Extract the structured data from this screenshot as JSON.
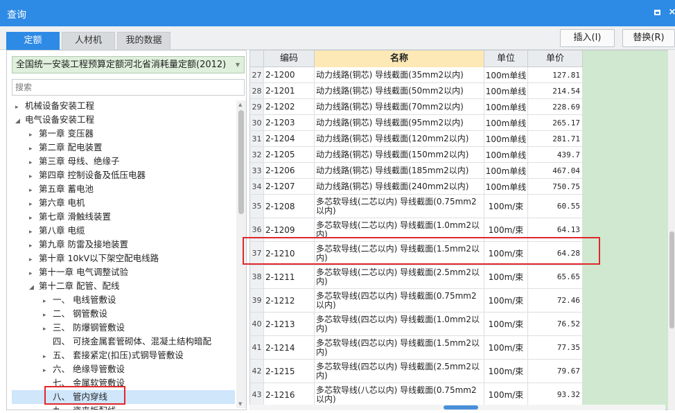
{
  "window": {
    "title": "查询",
    "maximize_icon": "maximize-icon",
    "close_label": "×"
  },
  "tabs": [
    {
      "label": "定额",
      "active": true
    },
    {
      "label": "人材机",
      "active": false
    },
    {
      "label": "我的数据",
      "active": false
    }
  ],
  "toolbar": {
    "insert_label": "插入(I)",
    "replace_label": "替换(R)"
  },
  "left": {
    "quota_combo": "全国统一安装工程预算定额河北省消耗量定额(2012)",
    "search_placeholder": "搜索",
    "tree": [
      {
        "label": "机械设备安装工程",
        "level": 0,
        "expander": "▸"
      },
      {
        "label": "电气设备安装工程",
        "level": 0,
        "expander": "◢"
      },
      {
        "label": "第一章 变压器",
        "level": 1,
        "expander": "▸"
      },
      {
        "label": "第二章 配电装置",
        "level": 1,
        "expander": "▸"
      },
      {
        "label": "第三章 母线、绝缘子",
        "level": 1,
        "expander": "▸"
      },
      {
        "label": "第四章 控制设备及低压电器",
        "level": 1,
        "expander": "▸"
      },
      {
        "label": "第五章 蓄电池",
        "level": 1,
        "expander": "▸"
      },
      {
        "label": "第六章 电机",
        "level": 1,
        "expander": "▸"
      },
      {
        "label": "第七章 滑触线装置",
        "level": 1,
        "expander": "▸"
      },
      {
        "label": "第八章 电缆",
        "level": 1,
        "expander": "▸"
      },
      {
        "label": "第九章 防雷及接地装置",
        "level": 1,
        "expander": "▸"
      },
      {
        "label": "第十章 10kV以下架空配电线路",
        "level": 1,
        "expander": "▸"
      },
      {
        "label": "第十一章 电气调整试验",
        "level": 1,
        "expander": "▸"
      },
      {
        "label": "第十二章 配管、配线",
        "level": 1,
        "expander": "◢"
      },
      {
        "label": "一、 电线管敷设",
        "level": 2,
        "expander": "▸"
      },
      {
        "label": "二、 钢管敷设",
        "level": 2,
        "expander": "▸"
      },
      {
        "label": "三、 防爆钢管敷设",
        "level": 2,
        "expander": "▸"
      },
      {
        "label": "四、 可挠金属套管砌体、混凝土结构暗配",
        "level": 2,
        "expander": ""
      },
      {
        "label": "五、 套接紧定(扣压)式钢导管敷设",
        "level": 2,
        "expander": "▸"
      },
      {
        "label": "六、 绝缘导管敷设",
        "level": 2,
        "expander": "▸"
      },
      {
        "label": "七、 金属软管敷设",
        "level": 2,
        "expander": ""
      },
      {
        "label": "八、 管内穿线",
        "level": 2,
        "expander": "",
        "selected": true
      },
      {
        "label": "九、 瓷夹板配线",
        "level": 2,
        "expander": ""
      }
    ]
  },
  "grid": {
    "headers": {
      "code": "编码",
      "name": "名称",
      "unit": "单位",
      "price": "单价"
    },
    "rows": [
      {
        "num": "27",
        "code": "2-1200",
        "name": "动力线路(铜芯) 导线截面(35mm2以内)",
        "unit": "100m单线",
        "price": "127.81",
        "tall": false
      },
      {
        "num": "28",
        "code": "2-1201",
        "name": "动力线路(铜芯) 导线截面(50mm2以内)",
        "unit": "100m单线",
        "price": "214.54",
        "tall": false
      },
      {
        "num": "29",
        "code": "2-1202",
        "name": "动力线路(铜芯) 导线截面(70mm2以内)",
        "unit": "100m单线",
        "price": "228.69",
        "tall": false
      },
      {
        "num": "30",
        "code": "2-1203",
        "name": "动力线路(铜芯) 导线截面(95mm2以内)",
        "unit": "100m单线",
        "price": "265.17",
        "tall": false
      },
      {
        "num": "31",
        "code": "2-1204",
        "name": "动力线路(铜芯) 导线截面(120mm2以内)",
        "unit": "100m单线",
        "price": "281.71",
        "tall": false
      },
      {
        "num": "32",
        "code": "2-1205",
        "name": "动力线路(铜芯) 导线截面(150mm2以内)",
        "unit": "100m单线",
        "price": "439.7",
        "tall": false
      },
      {
        "num": "33",
        "code": "2-1206",
        "name": "动力线路(铜芯) 导线截面(185mm2以内)",
        "unit": "100m单线",
        "price": "467.04",
        "tall": false
      },
      {
        "num": "34",
        "code": "2-1207",
        "name": "动力线路(铜芯) 导线截面(240mm2以内)",
        "unit": "100m单线",
        "price": "750.75",
        "tall": false
      },
      {
        "num": "35",
        "code": "2-1208",
        "name": "多芯软导线(二芯以内) 导线截面(0.75mm2以内)",
        "unit": "100m/束",
        "price": "60.55",
        "tall": true
      },
      {
        "num": "36",
        "code": "2-1209",
        "name": "多芯软导线(二芯以内) 导线截面(1.0mm2以内)",
        "unit": "100m/束",
        "price": "64.13",
        "tall": true
      },
      {
        "num": "37",
        "code": "2-1210",
        "name": "多芯软导线(二芯以内) 导线截面(1.5mm2以内)",
        "unit": "100m/束",
        "price": "64.28",
        "tall": true
      },
      {
        "num": "38",
        "code": "2-1211",
        "name": "多芯软导线(二芯以内) 导线截面(2.5mm2以内)",
        "unit": "100m/束",
        "price": "65.65",
        "tall": true
      },
      {
        "num": "39",
        "code": "2-1212",
        "name": "多芯软导线(四芯以内) 导线截面(0.75mm2以内)",
        "unit": "100m/束",
        "price": "72.46",
        "tall": true
      },
      {
        "num": "40",
        "code": "2-1213",
        "name": "多芯软导线(四芯以内) 导线截面(1.0mm2以内)",
        "unit": "100m/束",
        "price": "76.52",
        "tall": true
      },
      {
        "num": "41",
        "code": "2-1214",
        "name": "多芯软导线(四芯以内) 导线截面(1.5mm2以内)",
        "unit": "100m/束",
        "price": "77.35",
        "tall": true
      },
      {
        "num": "42",
        "code": "2-1215",
        "name": "多芯软导线(四芯以内) 导线截面(2.5mm2以内)",
        "unit": "100m/束",
        "price": "79.67",
        "tall": true
      },
      {
        "num": "43",
        "code": "2-1216",
        "name": "多芯软导线(八芯以内) 导线截面(0.75mm2以内)",
        "unit": "100m/束",
        "price": "93.32",
        "tall": true
      }
    ]
  },
  "colors": {
    "accent": "#2d8ae5",
    "highlight": "#e0262a",
    "green_bg": "#cfe8cf",
    "name_header": "#fde9b5"
  }
}
